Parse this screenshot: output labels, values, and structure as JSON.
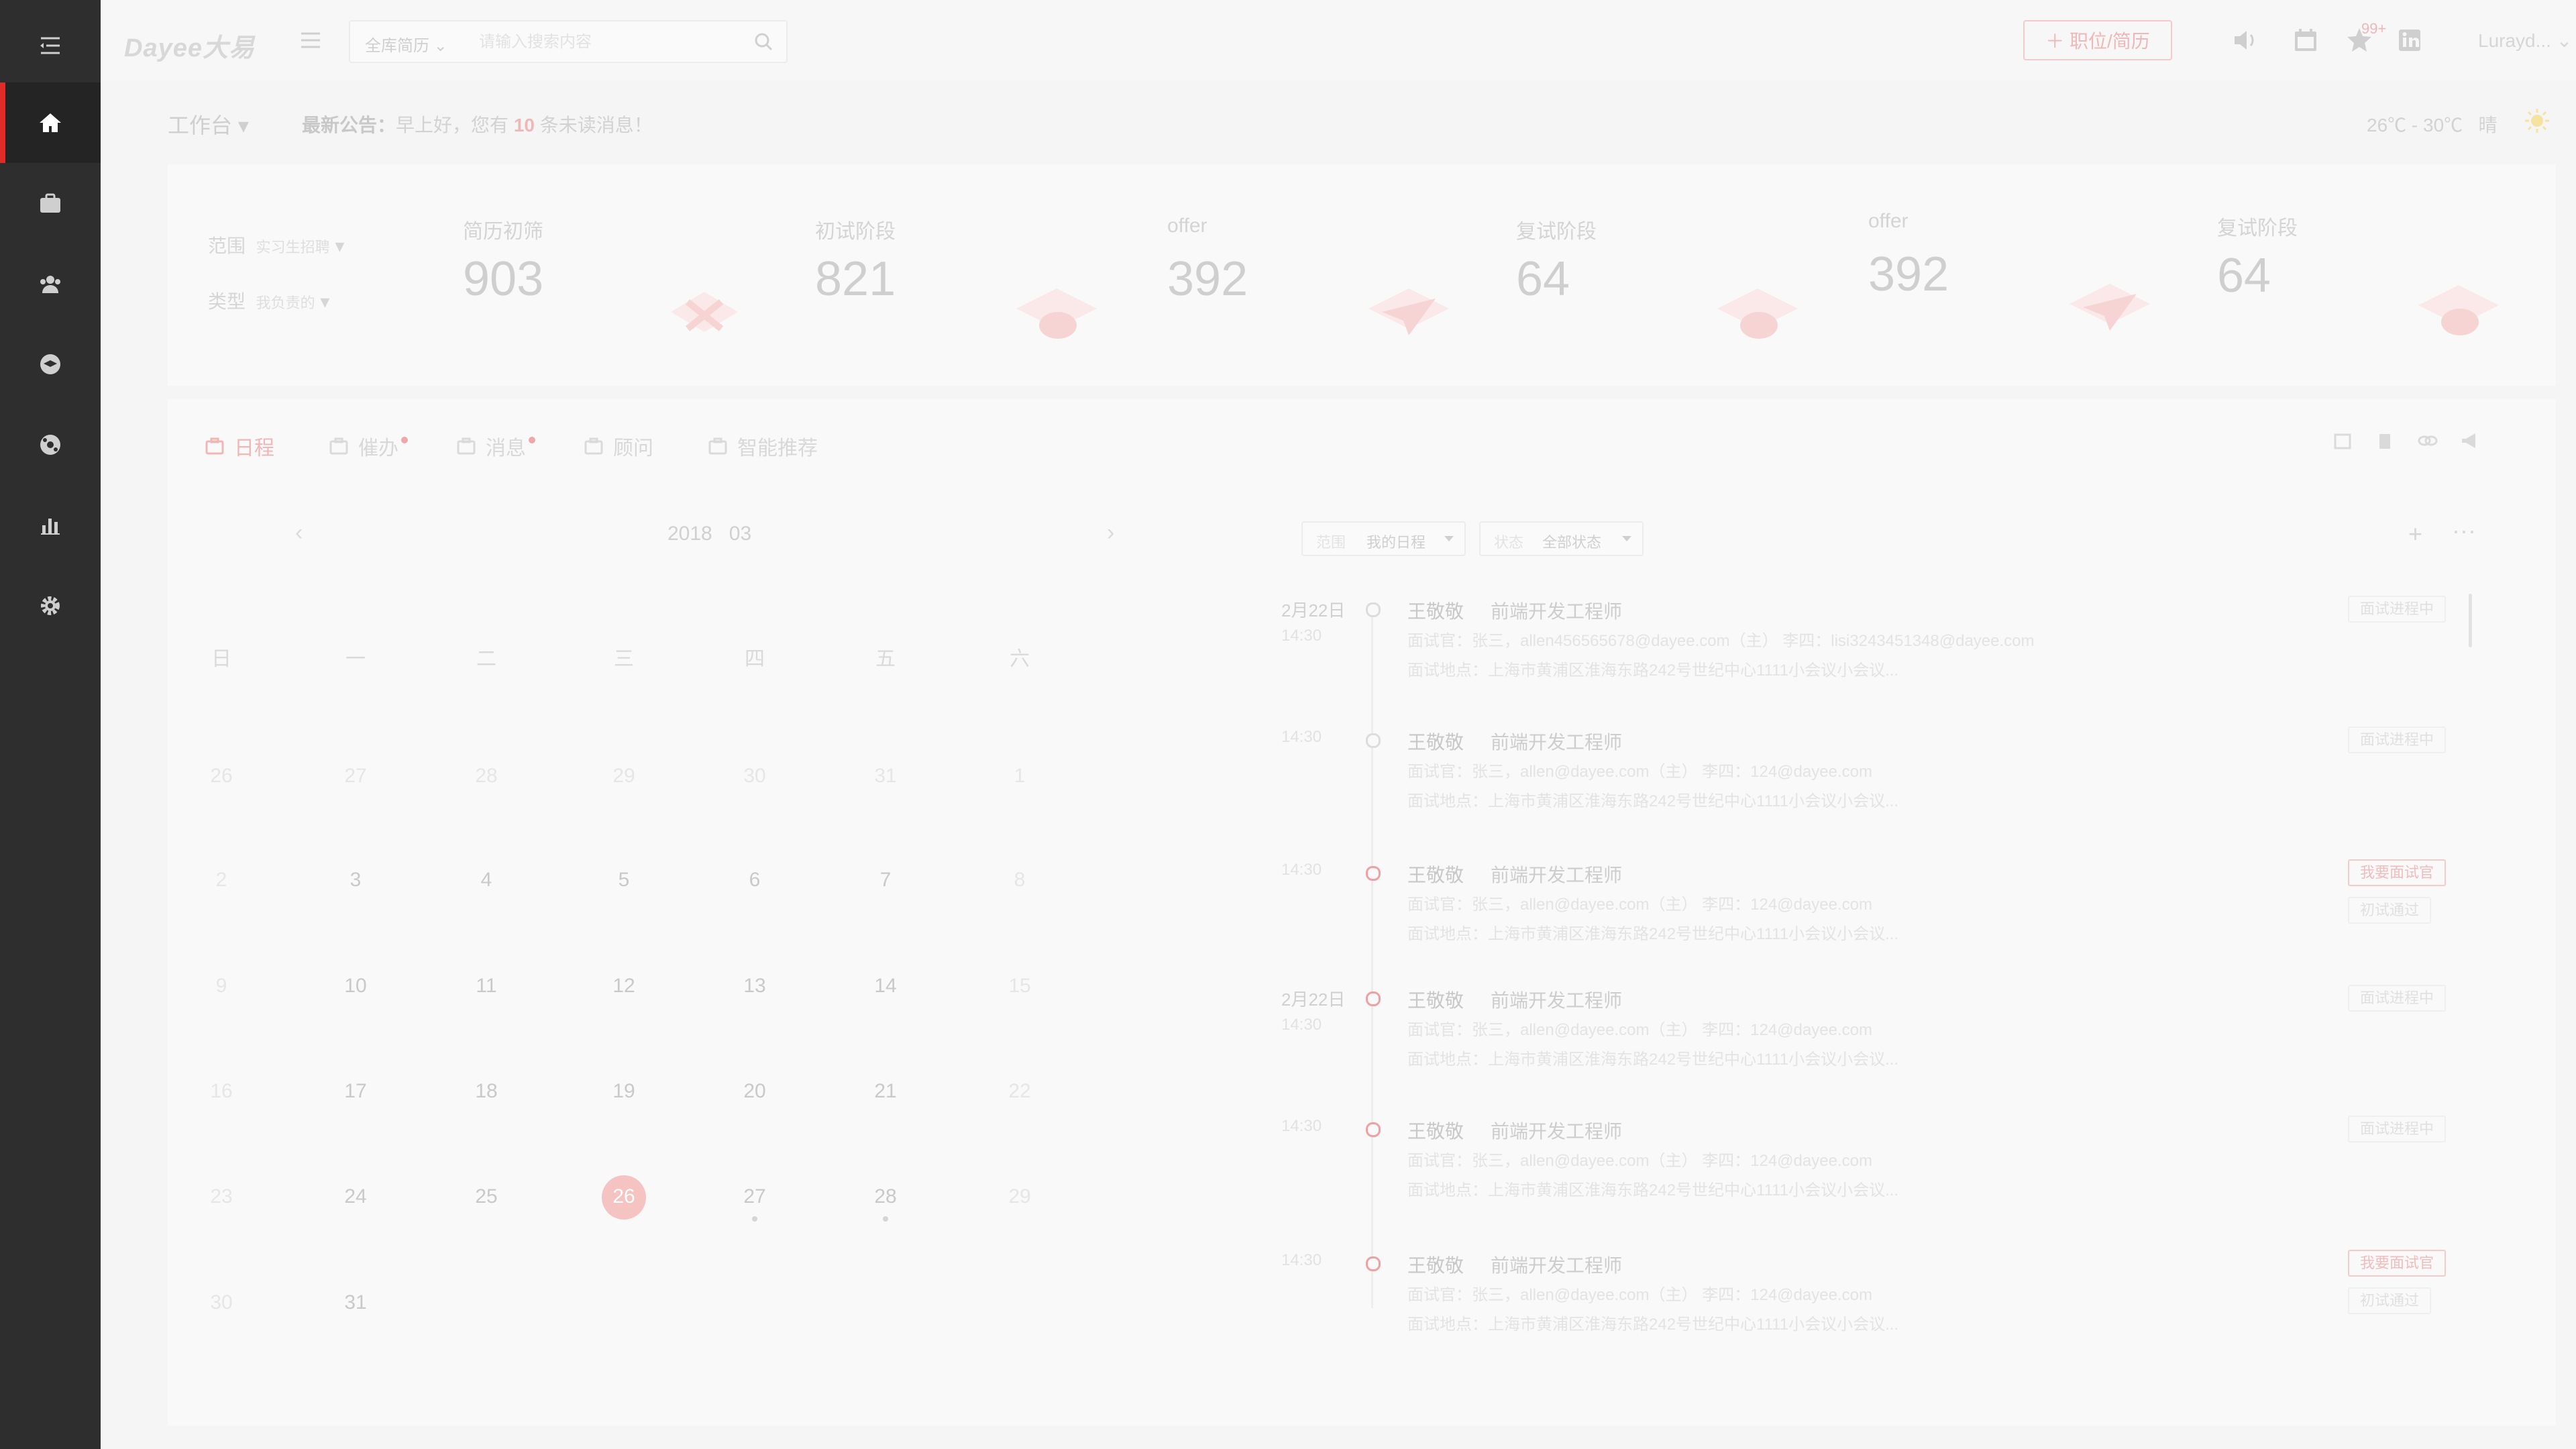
{
  "topbar": {
    "logo": "Dayee大易",
    "search": {
      "scope": "全库简历",
      "placeholder": "请输入搜索内容"
    },
    "add_button": "＋ 职位/简历",
    "notification_badge": "99+",
    "user": "Lurayd..."
  },
  "sidebar": {
    "items": [
      {
        "icon": "menu-icon"
      },
      {
        "icon": "home-icon",
        "active": true
      },
      {
        "icon": "briefcase-icon"
      },
      {
        "icon": "people-icon"
      },
      {
        "icon": "graduation-icon"
      },
      {
        "icon": "globe-icon"
      },
      {
        "icon": "bar-chart-icon"
      },
      {
        "icon": "gear-icon"
      }
    ]
  },
  "notice_bar": {
    "workbench": "工作台",
    "notice_label": "最新公告：",
    "notice_prefix": "早上好，您有",
    "notice_count": "10",
    "notice_suffix": "条未读消息！",
    "temperature": "26℃ - 30℃",
    "weather": "晴"
  },
  "stats": {
    "filters": [
      {
        "label": "范围",
        "value": "实习生招聘"
      },
      {
        "label": "类型",
        "value": "我负责的"
      }
    ],
    "items": [
      {
        "title": "简历初筛",
        "value": "903"
      },
      {
        "title": "初试阶段",
        "value": "821"
      },
      {
        "title": "offer",
        "value": "392"
      },
      {
        "title": "复试阶段",
        "value": "64"
      },
      {
        "title": "offer",
        "value": "392"
      },
      {
        "title": "复试阶段",
        "value": "64"
      }
    ]
  },
  "tabs": [
    {
      "label": "日程",
      "active": true
    },
    {
      "label": "催办",
      "dot": true
    },
    {
      "label": "消息",
      "dot": true
    },
    {
      "label": "顾问"
    },
    {
      "label": "智能推荐"
    }
  ],
  "calendar": {
    "year": "2018",
    "month": "03",
    "prev": "‹",
    "next": "›",
    "weekdays": [
      "日",
      "一",
      "二",
      "三",
      "四",
      "五",
      "六"
    ],
    "weeks": [
      [
        "26",
        "27",
        "28",
        "29",
        "30",
        "31",
        "1"
      ],
      [
        "2",
        "3",
        "4",
        "5",
        "6",
        "7",
        "8"
      ],
      [
        "9",
        "10",
        "11",
        "12",
        "13",
        "14",
        "15"
      ],
      [
        "16",
        "17",
        "18",
        "19",
        "20",
        "21",
        "22"
      ],
      [
        "23",
        "24",
        "25",
        "26",
        "27",
        "28",
        "29"
      ],
      [
        "30",
        "31",
        "",
        "",
        "",
        "",
        ""
      ]
    ],
    "today": "26"
  },
  "schedule": {
    "filter_scope_label": "范围",
    "filter_scope_value": "我的日程",
    "filter_status_label": "状态",
    "filter_status_value": "全部状态",
    "add": "+",
    "more": "···",
    "entries": [
      {
        "date": "2月22日",
        "time": "14:30",
        "name": "王敬敬",
        "role": "前端开发工程师",
        "line1": "面试官：张三，allen456565678@dayee.com（主） 李四：lisi3243451348@dayee.com",
        "line2": "面试地点：上海市黄浦区淮海东路242号世纪中心1111小会议小会议...",
        "tags": [
          "面试进程中"
        ],
        "tag_red": [
          false
        ],
        "dot_red": false
      },
      {
        "date": "",
        "time": "14:30",
        "name": "王敬敬",
        "role": "前端开发工程师",
        "line1": "面试官：张三，allen@dayee.com（主） 李四：124@dayee.com",
        "line2": "面试地点：上海市黄浦区淮海东路242号世纪中心1111小会议小会议...",
        "tags": [
          "面试进程中"
        ],
        "tag_red": [
          false
        ],
        "dot_red": false
      },
      {
        "date": "",
        "time": "14:30",
        "name": "王敬敬",
        "role": "前端开发工程师",
        "line1": "面试官：张三，allen@dayee.com（主） 李四：124@dayee.com",
        "line2": "面试地点：上海市黄浦区淮海东路242号世纪中心1111小会议小会议...",
        "tags": [
          "我要面试官",
          "初试通过"
        ],
        "tag_red": [
          true,
          false
        ],
        "dot_red": true
      },
      {
        "date": "2月22日",
        "time": "14:30",
        "name": "王敬敬",
        "role": "前端开发工程师",
        "line1": "面试官：张三，allen@dayee.com（主） 李四：124@dayee.com",
        "line2": "面试地点：上海市黄浦区淮海东路242号世纪中心1111小会议小会议...",
        "tags": [
          "面试进程中"
        ],
        "tag_red": [
          false
        ],
        "dot_red": true
      },
      {
        "date": "",
        "time": "14:30",
        "name": "王敬敬",
        "role": "前端开发工程师",
        "line1": "面试官：张三，allen@dayee.com（主） 李四：124@dayee.com",
        "line2": "面试地点：上海市黄浦区淮海东路242号世纪中心1111小会议小会议...",
        "tags": [
          "面试进程中"
        ],
        "tag_red": [
          false
        ],
        "dot_red": true
      },
      {
        "date": "",
        "time": "14:30",
        "name": "王敬敬",
        "role": "前端开发工程师",
        "line1": "面试官：张三，allen@dayee.com（主） 李四：124@dayee.com",
        "line2": "面试地点：上海市黄浦区淮海东路242号世纪中心1111小会议小会议...",
        "tags": [
          "我要面试官",
          "初试通过"
        ],
        "tag_red": [
          true,
          false
        ],
        "dot_red": true
      }
    ]
  },
  "colors": {
    "accent": "#e02b2b",
    "sidebar": "#2e2e2e",
    "faded_red": "#f0b7b7"
  }
}
